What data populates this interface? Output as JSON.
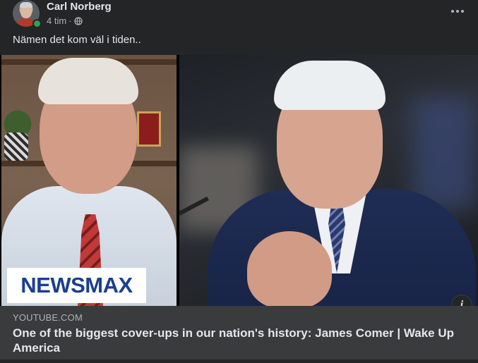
{
  "post": {
    "author": "Carl Norberg",
    "time": "4 tim",
    "separator": "·",
    "text": "Nämen det kom väl i tiden.."
  },
  "media": {
    "logo_text": "NEWSMAX"
  },
  "link": {
    "domain": "YOUTUBE.COM",
    "title": "One of the biggest cover-ups in our nation's history: James Comer | Wake Up America"
  },
  "icons": {
    "privacy": "globe-icon",
    "more": "more-options-icon",
    "info": "info-icon"
  },
  "colors": {
    "background": "#242526",
    "link_card": "#3a3b3c",
    "online": "#31a24c",
    "newsmax_blue": "#1a3f91"
  }
}
